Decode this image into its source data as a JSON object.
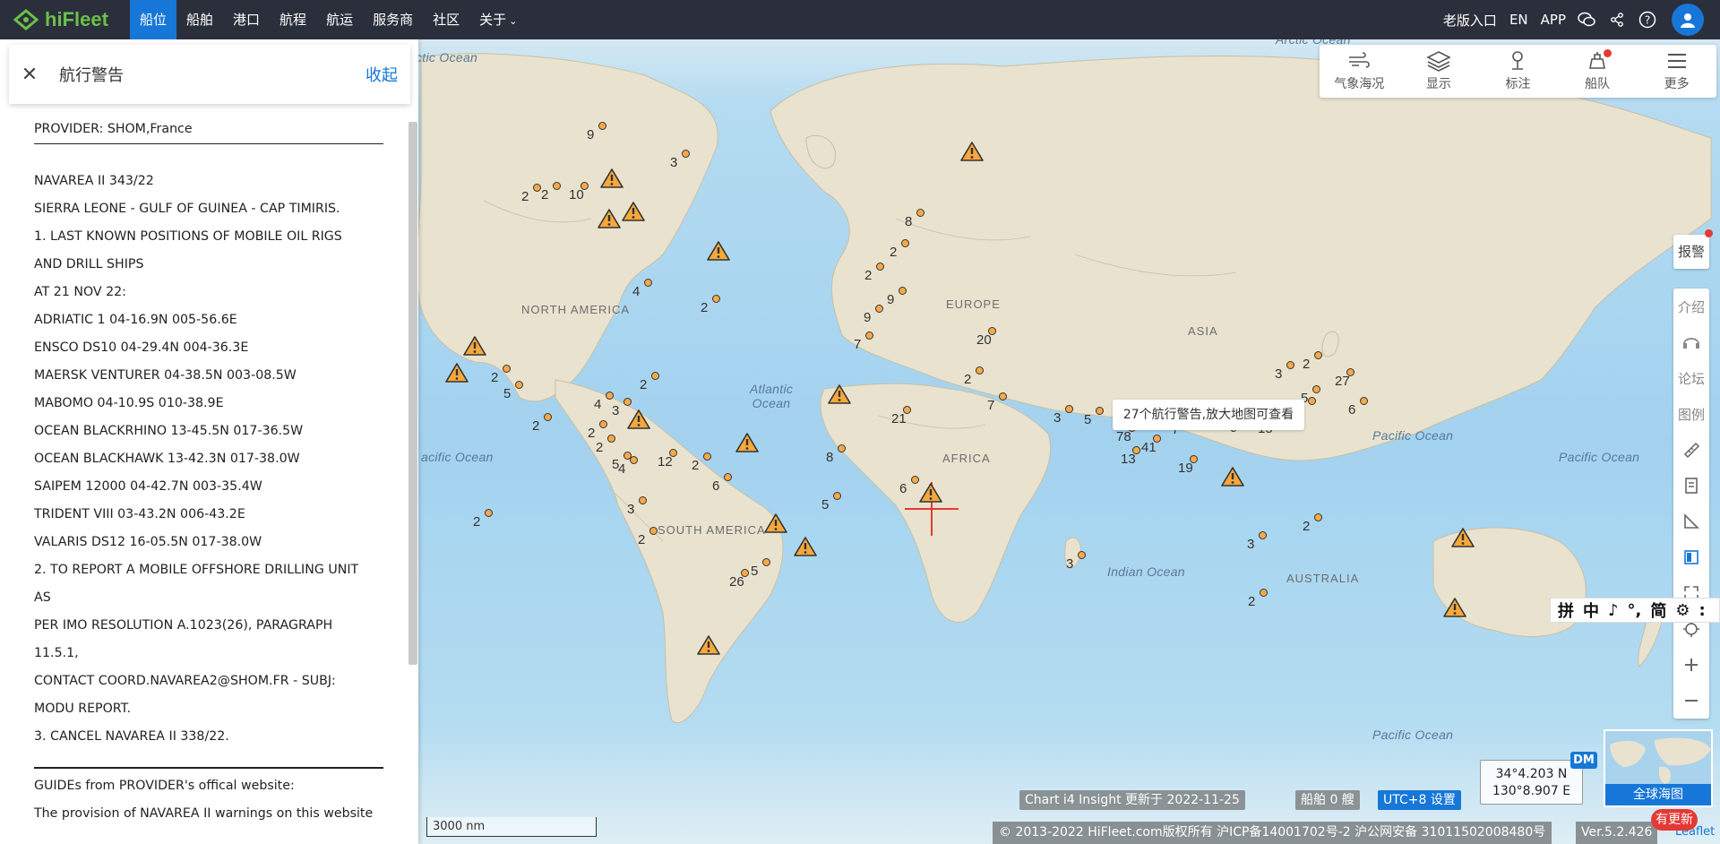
{
  "topbar": {
    "logo_text": "hiFleet",
    "nav": [
      "船位",
      "船舶",
      "港口",
      "航程",
      "航运",
      "服务商",
      "社区",
      "关于"
    ],
    "active_nav": "船位",
    "right_links": [
      "老版入口",
      "EN",
      "APP"
    ],
    "brand_color": "#1677d8",
    "logo_color": "#6cc04a"
  },
  "panel": {
    "title": "航行警告",
    "collapse_label": "收起",
    "provider": "PROVIDER: SHOM,France",
    "lines": [
      "NAVAREA II 343/22",
      "SIERRA LEONE - GULF OF GUINEA - CAP TIMIRIS.",
      "1. LAST KNOWN POSITIONS OF MOBILE OIL RIGS",
      "AND DRILL SHIPS",
      "AT 21 NOV 22:",
      "ADRIATIC 1 04-16.9N 005-56.6E",
      "ENSCO DS10 04-29.4N 004-36.3E",
      "MAERSK VENTURER 04-38.5N 003-08.5W",
      "MABOMO 04-10.9S 010-38.9E",
      "OCEAN BLACKRHINO 13-45.5N 017-36.5W",
      "OCEAN BLACKHAWK 13-42.3N 017-38.0W",
      "SAIPEM 12000 04-42.7N 003-35.4W",
      "TRIDENT VIII 03-43.2N 006-43.2E",
      "VALARIS DS12 16-05.5N 017-38.0W",
      "2. TO REPORT A MOBILE OFFSHORE DRILLING UNIT",
      "AS",
      "PER IMO RESOLUTION A.1023(26), PARAGRAPH",
      "11.5.1,",
      "CONTACT COORD.NAVAREA2@SHOM.FR - SUBJ:",
      "MODU REPORT.",
      "3. CANCEL NAVAREA II 338/22."
    ],
    "guide_title": "GUIDEs from PROVIDER's offical website:",
    "guide_text": "The provision of NAVAREA II warnings on this website"
  },
  "toolbar": {
    "items": [
      {
        "label": "气象海况",
        "icon": "weather-icon"
      },
      {
        "label": "显示",
        "icon": "layers-icon"
      },
      {
        "label": "标注",
        "icon": "pin-icon"
      },
      {
        "label": "船队",
        "icon": "fleet-icon"
      },
      {
        "label": "更多",
        "icon": "menu-icon"
      }
    ]
  },
  "rightbar": {
    "alarm": "报警",
    "items": [
      "介绍",
      "",
      "论坛",
      "图例"
    ]
  },
  "map": {
    "tooltip": "27个航行警告,放大地图可查看",
    "ocean_labels": [
      "ctic Ocean",
      "Arctic Ocean",
      "Atlantic Ocean",
      "acific Ocean",
      "Pacific Ocean",
      "Pacific Ocean",
      "Indian Ocean",
      "Pacific Ocean"
    ],
    "land_labels": [
      "NORTH AMERICA",
      "EUROPE",
      "ASIA",
      "AFRICA",
      "SOUTH AMERICA",
      "AUSTRALIA"
    ],
    "cluster_counts": [
      "9",
      "3",
      "2",
      "2",
      "10",
      "4",
      "2",
      "2",
      "5",
      "2",
      "4",
      "2",
      "2",
      "3",
      "2",
      "4",
      "5",
      "12",
      "2",
      "6",
      "8",
      "21",
      "5",
      "6",
      "2",
      "3",
      "2",
      "26",
      "5",
      "8",
      "2",
      "2",
      "9",
      "9",
      "20",
      "7",
      "2",
      "7",
      "3",
      "5",
      "78",
      "13",
      "41",
      "19",
      "7",
      "9",
      "15",
      "3",
      "2",
      "2",
      "5",
      "27",
      "6",
      "2",
      "3",
      "3",
      "2"
    ],
    "warning_count": 17
  },
  "ime": [
    "拼",
    "中",
    "♪",
    "°,",
    "简",
    "⚙",
    ":"
  ],
  "coords": {
    "lat": "34°4.203 N",
    "lon": "130°8.907 E",
    "format": "DM"
  },
  "minimap_label": "全球海图",
  "update_badge": "有更新",
  "chips": {
    "chart": "Chart i4 Insight 更新于 2022-11-25",
    "ships": "船舶 0 艘",
    "utc": "UTC+8 设置"
  },
  "scale": "3000 nm",
  "copyright": "© 2013-2022 HiFleet.com版权所有 沪ICP备14001702号-2 沪公网安备 31011502008480号",
  "version": "Ver.5.2.426",
  "leaflet": "Leaflet"
}
